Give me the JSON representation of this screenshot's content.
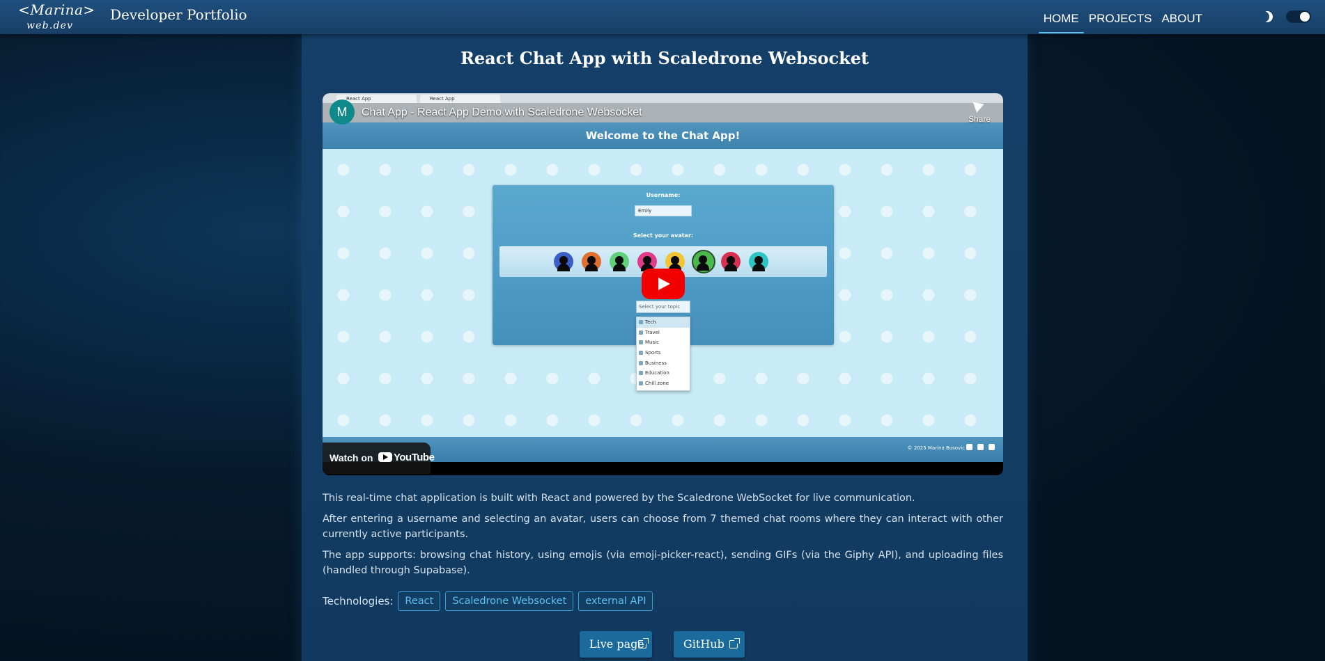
{
  "header": {
    "logo_line1": "<Marina>",
    "logo_line2": "web.dev",
    "site_title": "Developer Portfolio",
    "nav": [
      {
        "label": "HOME",
        "active": true
      },
      {
        "label": "PROJECTS",
        "active": false
      },
      {
        "label": "ABOUT",
        "active": false
      }
    ],
    "theme_icon": "half-moon-icon",
    "theme_toggle_state": "on"
  },
  "project": {
    "title": "React Chat App with Scaledrone Websocket",
    "video": {
      "channel_initial": "M",
      "title": "Chat App - React App Demo with Scaledrone Websocket",
      "share_label": "Share",
      "watch_on": "Watch on",
      "youtube_label": "YouTube",
      "browser_tab_1": "React App",
      "browser_tab_2": "React App",
      "app_heading": "Welcome to the Chat App!",
      "username_label": "Username:",
      "username_value": "Emily",
      "avatar_label": "Select your avatar:",
      "topic_placeholder": "Select your topic",
      "topics": [
        "Tech",
        "Travel",
        "Music",
        "Sports",
        "Business",
        "Education",
        "Chill zone"
      ],
      "footer_copyright": "© 2025 Marina Bosovic",
      "avatar_colors": [
        "#3b5ec9",
        "#e0702e",
        "#5fd07a",
        "#e03c8a",
        "#f2c432",
        "#4ab84a",
        "#d83050",
        "#2fc4c4"
      ]
    },
    "description": [
      "This real-time chat application is built with React and powered by the Scaledrone WebSocket for live communication.",
      "After entering a username and selecting an avatar, users can choose from 7 themed chat rooms where they can interact with other currently active participants.",
      "The app supports: browsing chat history, using emojis (via emoji-picker-react), sending GIFs (via the Giphy API), and uploading files (handled through Supabase)."
    ],
    "technologies_label": "Technologies:",
    "technologies": [
      "React",
      "Scaledrone Websocket",
      "external API"
    ],
    "buttons": {
      "live": "Live page",
      "github": "GitHub"
    }
  },
  "colors": {
    "header_bg": "#1f4f7d",
    "accent": "#5ec1f0",
    "card_bg": "#143f68",
    "button_bg": "#1a6a9c",
    "youtube_red": "#f20000"
  }
}
